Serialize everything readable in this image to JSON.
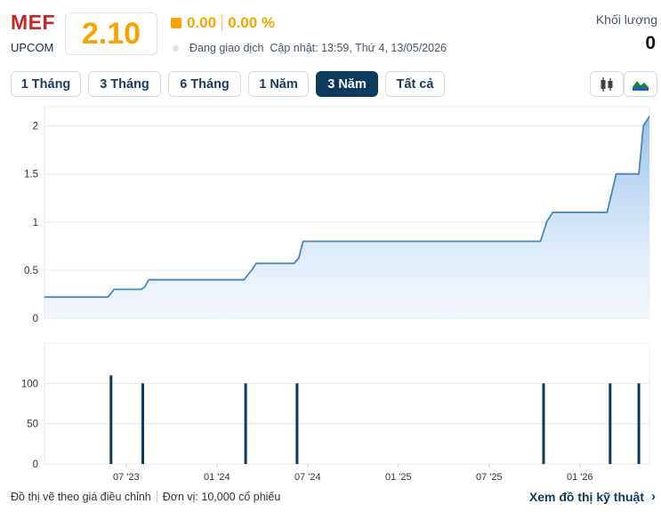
{
  "header": {
    "ticker": "MEF",
    "exchange": "UPCOM",
    "price": "2.10",
    "change": "0.00",
    "change_pct": "0.00 %",
    "status": "Đang giao dịch",
    "updated": "Cập nhật: 13:59, Thứ 4, 13/05/2026",
    "volume_label": "Khối lượng",
    "volume_value": "0"
  },
  "colors": {
    "up_neutral": "#f5a400",
    "ticker": "#c62828",
    "line": "#4a86b8",
    "bar": "#0c3b5e",
    "active_tab": "#0c3b5e"
  },
  "tabs": [
    {
      "label": "1 Tháng",
      "active": false
    },
    {
      "label": "3 Tháng",
      "active": false
    },
    {
      "label": "6 Tháng",
      "active": false
    },
    {
      "label": "1 Năm",
      "active": false
    },
    {
      "label": "3 Năm",
      "active": true
    },
    {
      "label": "Tất cả",
      "active": false
    }
  ],
  "chart_type_icons": [
    "candlestick-icon",
    "area-chart-icon"
  ],
  "chart_data": [
    {
      "type": "area",
      "y_ticks": [
        "0",
        "0.5",
        "1",
        "1.5",
        "2"
      ],
      "ylim": [
        0,
        2.2
      ],
      "x_ticks": [
        "07 '23",
        "01 '24",
        "07 '24",
        "01 '25",
        "07 '25",
        "01 '26"
      ],
      "x_tick_months": [
        6,
        12,
        18,
        24,
        30,
        36
      ],
      "xlim_months": [
        0.6,
        40.6
      ],
      "grid": true,
      "series": [
        {
          "points": [
            [
              0.6,
              0.22
            ],
            [
              4.8,
              0.22
            ],
            [
              5.2,
              0.3
            ],
            [
              7.0,
              0.3
            ],
            [
              7.2,
              0.32
            ],
            [
              7.5,
              0.4
            ],
            [
              13.8,
              0.4
            ],
            [
              14.3,
              0.5
            ],
            [
              14.6,
              0.57
            ],
            [
              17.1,
              0.57
            ],
            [
              17.4,
              0.62
            ],
            [
              17.7,
              0.8
            ],
            [
              33.4,
              0.8
            ],
            [
              33.8,
              1.0
            ],
            [
              34.2,
              1.1
            ],
            [
              37.8,
              1.1
            ],
            [
              38.1,
              1.3
            ],
            [
              38.4,
              1.5
            ],
            [
              39.9,
              1.5
            ],
            [
              40.2,
              2.0
            ],
            [
              40.6,
              2.1
            ]
          ]
        }
      ]
    },
    {
      "type": "bar",
      "y_ticks": [
        "0",
        "50",
        "100"
      ],
      "ylim": [
        0,
        150
      ],
      "series": [
        {
          "points": [
            [
              5.0,
              110
            ],
            [
              7.1,
              100
            ],
            [
              13.9,
              100
            ],
            [
              17.3,
              100
            ],
            [
              33.6,
              100
            ],
            [
              38.0,
              100
            ],
            [
              39.9,
              100
            ]
          ]
        }
      ]
    }
  ],
  "footer": {
    "note": "Đồ thị vẽ theo giá điều chỉnh",
    "unit": "Đơn vị: 10,000 cổ phiếu",
    "tech_link": "Xem đồ thị kỹ thuật",
    "tech_arrow": "›"
  }
}
